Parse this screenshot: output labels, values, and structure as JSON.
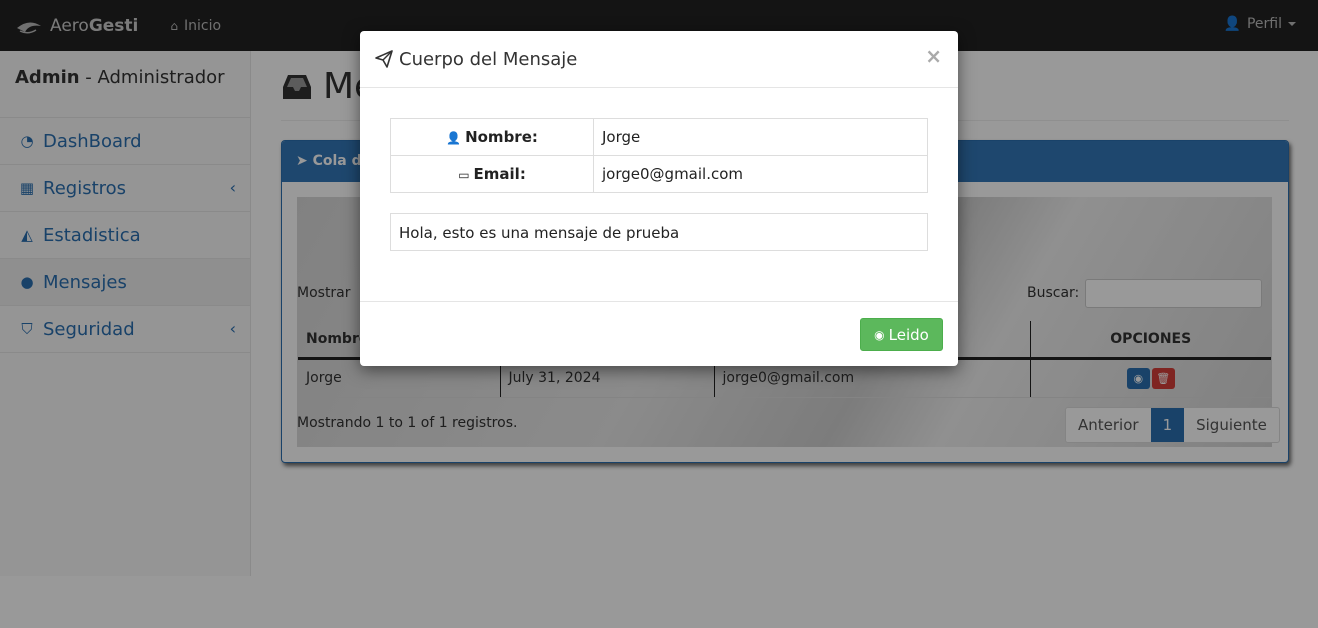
{
  "navbar": {
    "brand_prefix": "Aero",
    "brand_suffix": "Gesti",
    "home_label": "Inicio",
    "profile_label": "Perfil"
  },
  "sidebar": {
    "user_name": "Admin",
    "user_role": " - Administrador",
    "items": [
      {
        "label": "DashBoard",
        "icon": "dashboard-icon"
      },
      {
        "label": "Registros",
        "icon": "table-icon",
        "has_submenu": true
      },
      {
        "label": "Estadistica",
        "icon": "area-chart-icon"
      },
      {
        "label": "Mensajes",
        "icon": "comment-icon",
        "active": true
      },
      {
        "label": "Seguridad",
        "icon": "shield-icon",
        "has_submenu": true
      }
    ]
  },
  "main": {
    "title_fragment": "Me",
    "panel_title_fragment": "Cola d",
    "show_label": "Mostrar",
    "search_label": "Buscar:",
    "table": {
      "headers": [
        "Nombre",
        "",
        "",
        "OPCIONES"
      ],
      "rows": [
        {
          "name": "Jorge",
          "date": "July 31, 2024",
          "email": "jorge0@gmail.com"
        }
      ]
    },
    "info_text": "Mostrando 1 to 1 of 1 registros.",
    "pagination": {
      "prev": "Anterior",
      "current": "1",
      "next": "Siguiente"
    }
  },
  "modal": {
    "title": "Cuerpo del Mensaje",
    "close_symbol": "×",
    "name_label": "Nombre:",
    "name_value": "Jorge",
    "email_label": "Email:",
    "email_value": "jorge0@gmail.com",
    "message": "Hola, esto es una mensaje de prueba",
    "read_button": "Leido"
  },
  "colors": {
    "navbar": "#222222",
    "primary": "#3377b8",
    "success": "#5cb85c",
    "danger": "#d43f3a"
  }
}
